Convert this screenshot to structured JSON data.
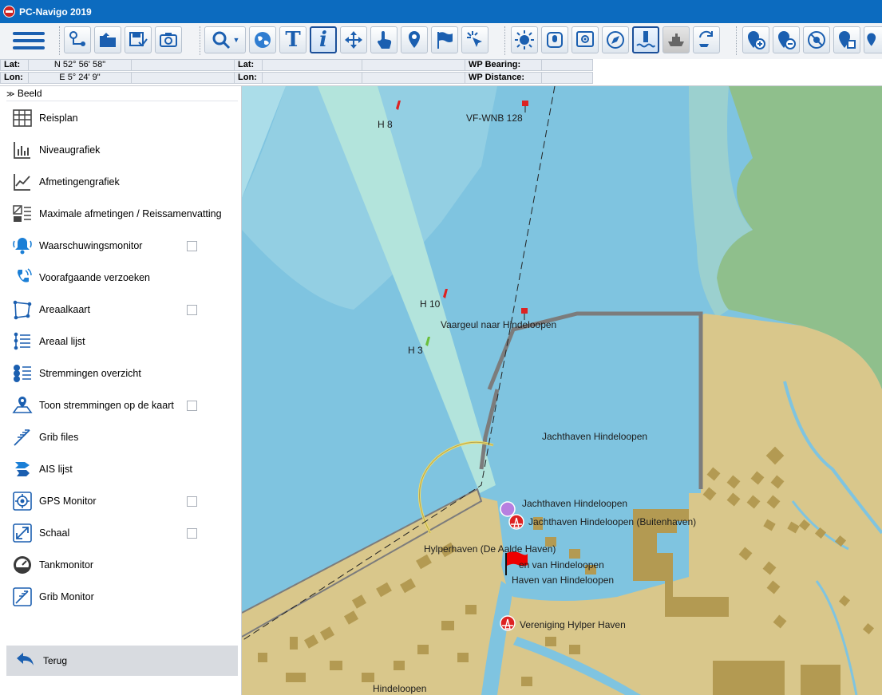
{
  "window": {
    "title": "PC-Navigo 2019"
  },
  "coords": {
    "lat_label": "Lat:",
    "lat_value": "N 52° 56' 58\"",
    "lon_label": "Lon:",
    "lon_value": "E 5° 24' 9\"",
    "lat2_label": "Lat:",
    "lon2_label": "Lon:",
    "wp_bearing_label": "WP Bearing:",
    "wp_distance_label": "WP Distance:"
  },
  "sidebar": {
    "header": "Beeld",
    "items": [
      {
        "label": "Reisplan",
        "icon": "grid-icon",
        "checkbox": false
      },
      {
        "label": "Niveaugrafiek",
        "icon": "bar-chart-icon",
        "checkbox": false
      },
      {
        "label": "Afmetingengrafiek",
        "icon": "line-chart-icon",
        "checkbox": false
      },
      {
        "label": "Maximale afmetingen / Reissamenvatting",
        "icon": "dimensions-icon",
        "checkbox": false
      },
      {
        "label": "Waarschuwingsmonitor",
        "icon": "bell-icon",
        "checkbox": true
      },
      {
        "label": "Voorafgaande verzoeken",
        "icon": "phone-icon",
        "checkbox": false
      },
      {
        "label": "Areaalkaart",
        "icon": "area-map-icon",
        "checkbox": true
      },
      {
        "label": "Areaal lijst",
        "icon": "area-list-icon",
        "checkbox": false
      },
      {
        "label": "Stremmingen overzicht",
        "icon": "obstruction-list-icon",
        "checkbox": false
      },
      {
        "label": "Toon stremmingen op de kaart",
        "icon": "obstruction-map-icon",
        "checkbox": true
      },
      {
        "label": "Grib files",
        "icon": "wind-icon",
        "checkbox": false
      },
      {
        "label": "AIS lijst",
        "icon": "ais-icon",
        "checkbox": false
      },
      {
        "label": "GPS Monitor",
        "icon": "gps-icon",
        "checkbox": true
      },
      {
        "label": "Schaal",
        "icon": "scale-icon",
        "checkbox": true
      },
      {
        "label": "Tankmonitor",
        "icon": "gauge-icon",
        "checkbox": false
      },
      {
        "label": "Grib Monitor",
        "icon": "grib-monitor-icon",
        "checkbox": false
      }
    ],
    "back_label": "Terug"
  },
  "map": {
    "labels": {
      "h8": "H 8",
      "vf": "VF-WNB 128",
      "h10": "H 10",
      "vaargeul": "Vaargeul naar Hindeloopen",
      "h3": "H 3",
      "jacht": "Jachthaven Hindeloopen",
      "jacht2": "Jachthaven Hindeloopen",
      "buiten": "Jachthaven Hindeloopen (Buitenhaven)",
      "hylper": "Hylperhaven (De Aalde Haven)",
      "haven1": "en van Hindeloopen",
      "haven2": "Haven van Hindeloopen",
      "vereniging": "Vereniging Hylper Haven",
      "town": "Hindeloopen"
    },
    "colors": {
      "water": "#7fc4e0",
      "land": "#d9c78b",
      "green": "#8fbf8c",
      "channel": "#b3e4dc"
    }
  }
}
